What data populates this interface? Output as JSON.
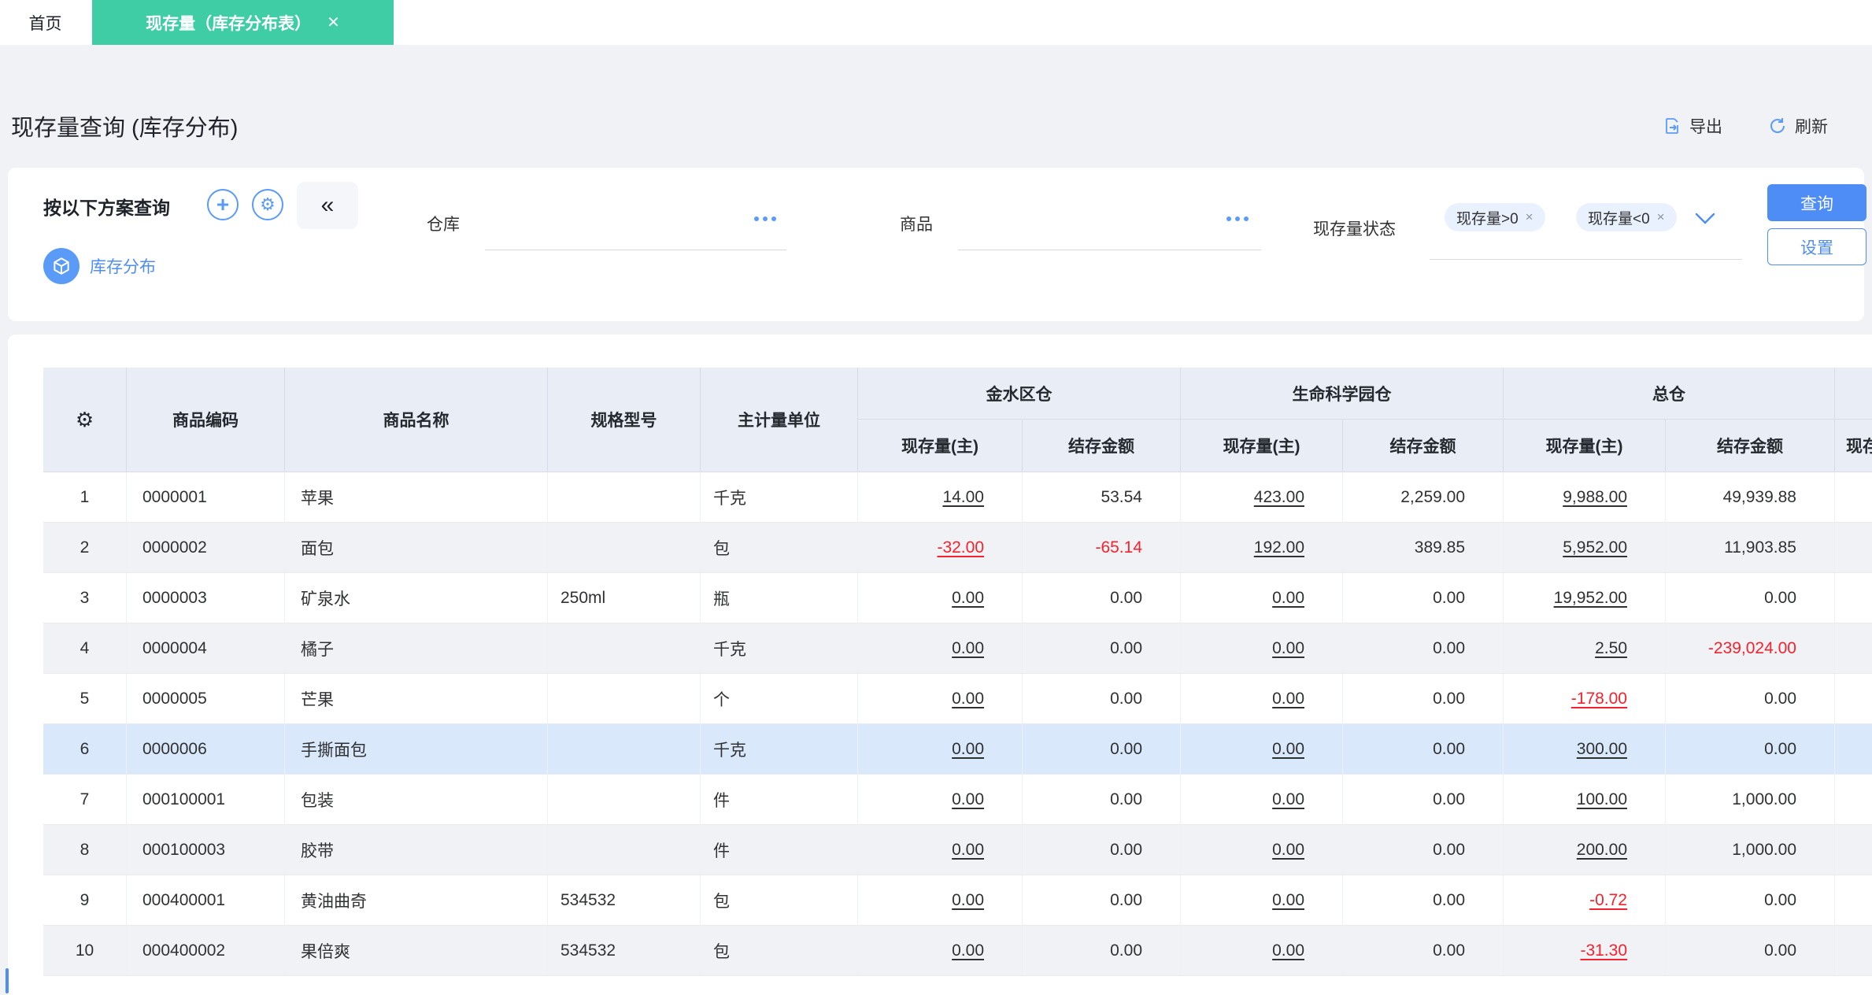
{
  "tabs": {
    "home": "首页",
    "active": "现存量（库存分布表）",
    "close": "✕"
  },
  "header": {
    "title": "现存量查询 (库存分布)",
    "export_label": "导出",
    "refresh_label": "刷新"
  },
  "filter": {
    "scheme_title": "按以下方案查询",
    "plus_icon": "+",
    "gear_icon": "⚙",
    "collapse_icon": "«",
    "scheme_item": "库存分布",
    "warehouse_label": "仓库",
    "product_label": "商品",
    "status_label": "现存量状态",
    "tags": [
      {
        "label": "现存量>0",
        "close": "×"
      },
      {
        "label": "现存量<0",
        "close": "×"
      }
    ],
    "query_button": "查询",
    "settings_button": "设置"
  },
  "table": {
    "gear_icon": "⚙",
    "columns": {
      "code": "商品编码",
      "name": "商品名称",
      "spec": "规格型号",
      "unit": "主计量单位"
    },
    "sub_qty": "现存量(主)",
    "sub_amount": "结存金额",
    "groups": [
      "金水区仓",
      "生命科学园仓",
      "总仓"
    ],
    "partial_group": "",
    "partial_sub": "现存量(主)",
    "rows": [
      {
        "num": "1",
        "code": "0000001",
        "name": "苹果",
        "spec": "",
        "unit": "千克",
        "values": [
          "14.00",
          "53.54",
          "423.00",
          "2,259.00",
          "9,988.00",
          "49,939.88"
        ]
      },
      {
        "num": "2",
        "code": "0000002",
        "name": "面包",
        "spec": "",
        "unit": "包",
        "values": [
          "-32.00",
          "-65.14",
          "192.00",
          "389.85",
          "5,952.00",
          "11,903.85"
        ]
      },
      {
        "num": "3",
        "code": "0000003",
        "name": "矿泉水",
        "spec": "250ml",
        "unit": "瓶",
        "values": [
          "0.00",
          "0.00",
          "0.00",
          "0.00",
          "19,952.00",
          "0.00"
        ]
      },
      {
        "num": "4",
        "code": "0000004",
        "name": "橘子",
        "spec": "",
        "unit": "千克",
        "values": [
          "0.00",
          "0.00",
          "0.00",
          "0.00",
          "2.50",
          "-239,024.00"
        ]
      },
      {
        "num": "5",
        "code": "0000005",
        "name": "芒果",
        "spec": "",
        "unit": "个",
        "values": [
          "0.00",
          "0.00",
          "0.00",
          "0.00",
          "-178.00",
          "0.00"
        ]
      },
      {
        "num": "6",
        "code": "0000006",
        "name": "手撕面包",
        "spec": "",
        "unit": "千克",
        "selected": true,
        "values": [
          "0.00",
          "0.00",
          "0.00",
          "0.00",
          "300.00",
          "0.00"
        ]
      },
      {
        "num": "7",
        "code": "000100001",
        "name": "包装",
        "spec": "",
        "unit": "件",
        "values": [
          "0.00",
          "0.00",
          "0.00",
          "0.00",
          "100.00",
          "1,000.00"
        ]
      },
      {
        "num": "8",
        "code": "000100003",
        "name": "胶带",
        "spec": "",
        "unit": "件",
        "values": [
          "0.00",
          "0.00",
          "0.00",
          "0.00",
          "200.00",
          "1,000.00"
        ]
      },
      {
        "num": "9",
        "code": "000400001",
        "name": "黄油曲奇",
        "spec": "534532",
        "unit": "包",
        "values": [
          "0.00",
          "0.00",
          "0.00",
          "0.00",
          "-0.72",
          "0.00"
        ]
      },
      {
        "num": "10",
        "code": "000400002",
        "name": "果倍爽",
        "spec": "534532",
        "unit": "包",
        "values": [
          "0.00",
          "0.00",
          "0.00",
          "0.00",
          "-31.30",
          "0.00"
        ]
      }
    ]
  },
  "colors": {
    "tab_teal": "#3ecda4",
    "accent_blue": "#4d8df5",
    "icon_blue": "#5b9bf8",
    "negative_red": "#f5222d",
    "selected_row": "#d9e8fb"
  }
}
